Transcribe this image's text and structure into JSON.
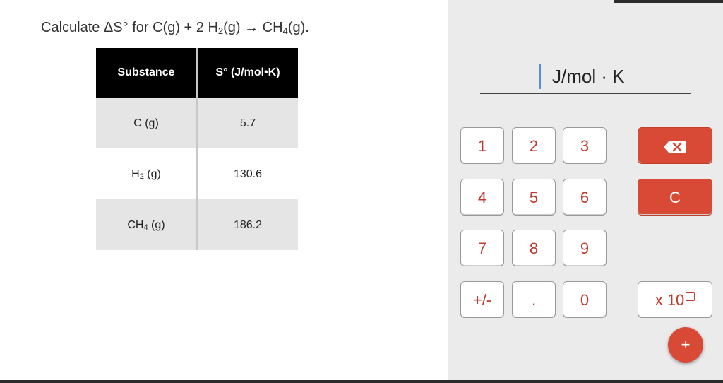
{
  "question": {
    "prefix": "Calculate ΔS° for C(g) + 2 H",
    "sub1": "2",
    "middle": "(g) → CH",
    "sub2": "4",
    "suffix": "(g)."
  },
  "table": {
    "headers": [
      "Substance",
      "S° (J/mol•K)"
    ],
    "rows": [
      {
        "substance": "C (g)",
        "sub": "",
        "substance_tail": "",
        "value": "5.7"
      },
      {
        "substance": "H",
        "sub": "2",
        "substance_tail": " (g)",
        "value": "130.6"
      },
      {
        "substance": "CH",
        "sub": "4",
        "substance_tail": " (g)",
        "value": "186.2"
      }
    ]
  },
  "answer": {
    "value": "",
    "unit": "J/mol · K"
  },
  "keypad": {
    "k1": "1",
    "k2": "2",
    "k3": "3",
    "k4": "4",
    "k5": "5",
    "k6": "6",
    "k7": "7",
    "k8": "8",
    "k9": "9",
    "plusminus": "+/-",
    "dot": ".",
    "k0": "0",
    "clear": "C",
    "x10": "x 10",
    "fab": "+"
  },
  "colors": {
    "accent_red": "#d94a36",
    "digit_red": "#c0392b",
    "panel_gray": "#ebebeb"
  }
}
